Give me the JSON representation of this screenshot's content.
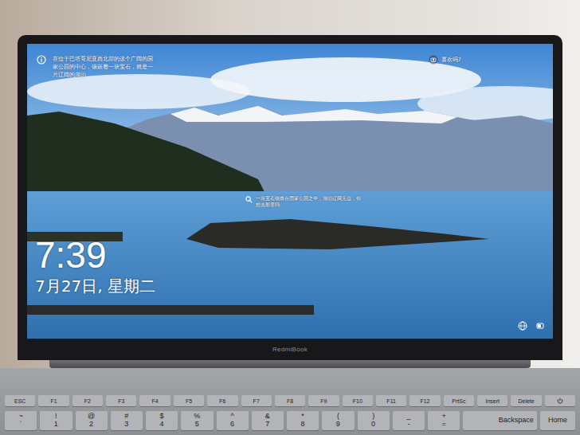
{
  "lock_screen": {
    "spotlight_text": "在位于巴塔哥尼亚西北部的这个广阔的国家公园的中心，镶嵌着一块宝石，就是一片辽阔的湖泊",
    "like_prompt": "喜欢吗?",
    "caption": "一块宝石镶嵌在国家公园之中，湖泊辽阔无边，你想去那里吗",
    "time": "7:39",
    "date": "7月27日, 星期二"
  },
  "laptop": {
    "brand": "RedmiBook"
  },
  "keyboard": {
    "function_row": [
      {
        "label": "ESC"
      },
      {
        "label": "F1"
      },
      {
        "label": "F2"
      },
      {
        "label": "F3"
      },
      {
        "label": "F4"
      },
      {
        "label": "F5"
      },
      {
        "label": "F6"
      },
      {
        "label": "F7"
      },
      {
        "label": "F8"
      },
      {
        "label": "F9"
      },
      {
        "label": "F10"
      },
      {
        "label": "F11"
      },
      {
        "label": "F12"
      },
      {
        "label": "PrtSc"
      },
      {
        "label": "Insert"
      },
      {
        "label": "Delete"
      }
    ],
    "number_row": [
      {
        "kind": "dual",
        "top": "~",
        "bottom": "`"
      },
      {
        "kind": "dual",
        "top": "!",
        "bottom": "1"
      },
      {
        "kind": "dual",
        "top": "@",
        "bottom": "2"
      },
      {
        "kind": "dual",
        "top": "#",
        "bottom": "3"
      },
      {
        "kind": "dual",
        "top": "$",
        "bottom": "4"
      },
      {
        "kind": "dual",
        "top": "%",
        "bottom": "5"
      },
      {
        "kind": "dual",
        "top": "^",
        "bottom": "6"
      },
      {
        "kind": "dual",
        "top": "&",
        "bottom": "7"
      },
      {
        "kind": "dual",
        "top": "*",
        "bottom": "8"
      },
      {
        "kind": "dual",
        "top": "(",
        "bottom": "9"
      },
      {
        "kind": "dual",
        "top": ")",
        "bottom": "0"
      },
      {
        "kind": "dual",
        "top": "_",
        "bottom": "-"
      },
      {
        "kind": "dual",
        "top": "+",
        "bottom": "="
      },
      {
        "kind": "wide",
        "label": "Backspace"
      },
      {
        "kind": "single",
        "label": "Home"
      }
    ]
  }
}
